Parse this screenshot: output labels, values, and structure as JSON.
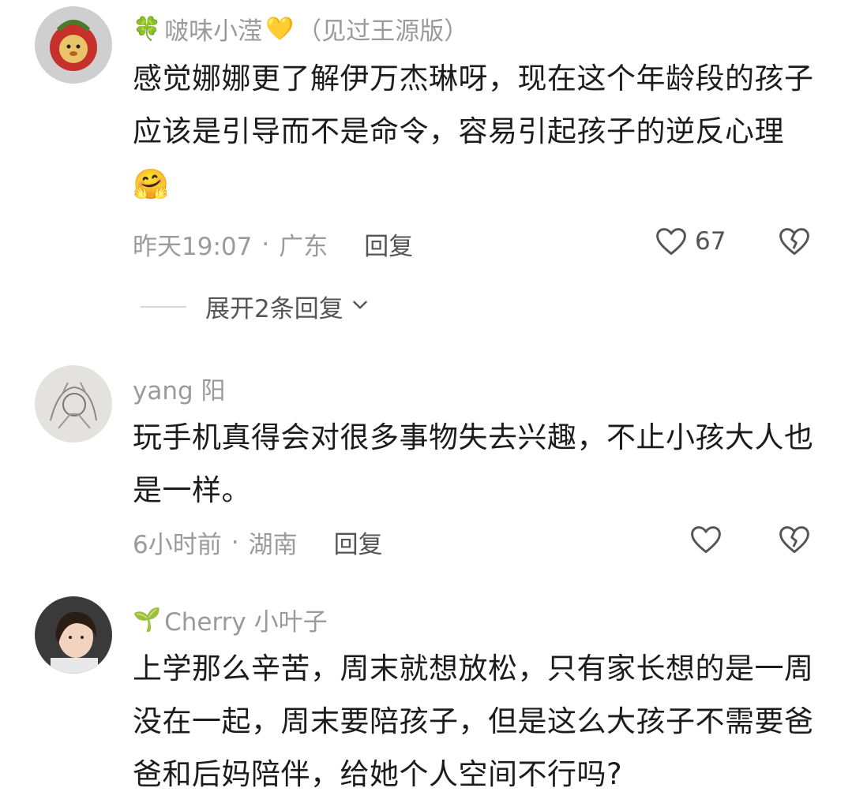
{
  "comments": [
    {
      "username_prefix": "🍀",
      "username": "啵味小滢",
      "username_suffix": "💛",
      "badge": "（见过王源版）",
      "text": "感觉娜娜更了解伊万杰琳呀，现在这个年龄段的孩子应该是引导而不是命令，容易引起孩子的逆反心理🤗",
      "time": "昨天19:07",
      "location": "广东",
      "reply_label": "回复",
      "like_count": "67",
      "expand_label": "展开2条回复"
    },
    {
      "username": "yang 阳",
      "text": "玩手机真得会对很多事物失去兴趣，不止小孩大人也是一样。",
      "time": "6小时前",
      "location": "湖南",
      "reply_label": "回复",
      "like_count": ""
    },
    {
      "username_prefix": "🌱",
      "username": "Cherry 小叶子",
      "text": "上学那么辛苦，周末就想放松，只有家长想的是一周没在一起，周末要陪孩子，但是这么大孩子不需要爸爸和后妈陪伴，给她个人空间不行吗?"
    }
  ],
  "separator": "·",
  "icons": {
    "like": "heart-outline-icon",
    "dislike": "broken-heart-icon",
    "expand": "chevron-down-icon"
  },
  "colors": {
    "meta_gray": "#9b9b9b",
    "reply_gray": "#555555",
    "text": "#1c1c1c"
  }
}
